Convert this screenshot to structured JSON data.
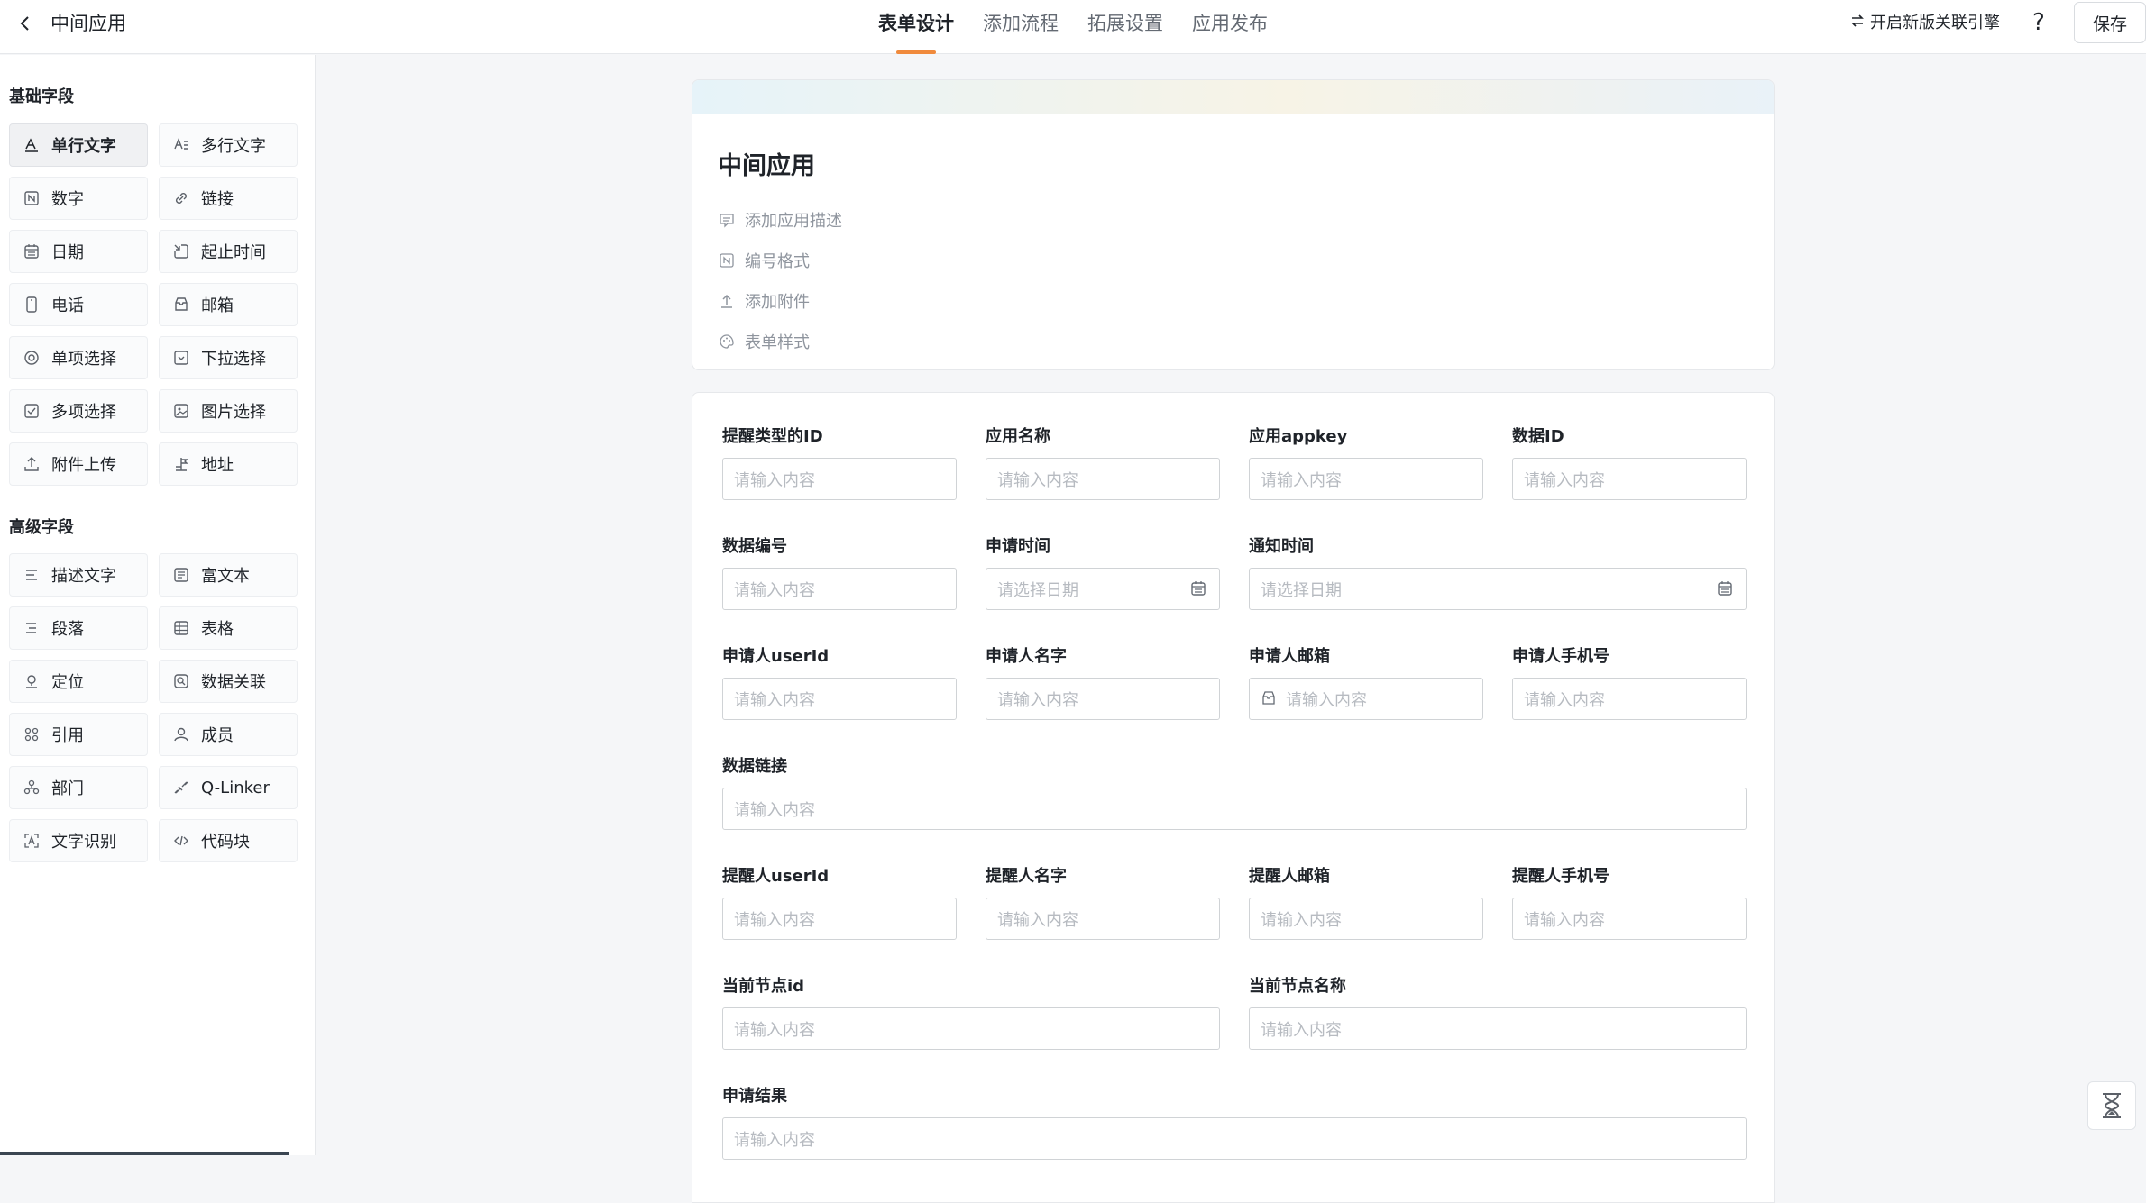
{
  "header": {
    "app_name": "中间应用",
    "tabs": [
      "表单设计",
      "添加流程",
      "拓展设置",
      "应用发布"
    ],
    "active_tab": "表单设计",
    "engine_label": "开启新版关联引擎",
    "help_label": "?",
    "save_label": "保存"
  },
  "sidebar": {
    "basic_title": "基础字段",
    "basic_fields": [
      {
        "label": "单行文字",
        "icon": "single-line-text-icon"
      },
      {
        "label": "多行文字",
        "icon": "multi-line-text-icon"
      },
      {
        "label": "数字",
        "icon": "number-icon"
      },
      {
        "label": "链接",
        "icon": "link-icon"
      },
      {
        "label": "日期",
        "icon": "calendar-icon"
      },
      {
        "label": "起止时间",
        "icon": "time-range-icon"
      },
      {
        "label": "电话",
        "icon": "phone-icon"
      },
      {
        "label": "邮箱",
        "icon": "mail-icon"
      },
      {
        "label": "单项选择",
        "icon": "radio-icon"
      },
      {
        "label": "下拉选择",
        "icon": "dropdown-icon"
      },
      {
        "label": "多项选择",
        "icon": "checkbox-icon"
      },
      {
        "label": "图片选择",
        "icon": "image-icon"
      },
      {
        "label": "附件上传",
        "icon": "upload-icon"
      },
      {
        "label": "地址",
        "icon": "address-icon"
      }
    ],
    "advanced_title": "高级字段",
    "advanced_fields": [
      {
        "label": "描述文字",
        "icon": "description-icon"
      },
      {
        "label": "富文本",
        "icon": "rich-text-icon"
      },
      {
        "label": "段落",
        "icon": "paragraph-icon"
      },
      {
        "label": "表格",
        "icon": "table-icon"
      },
      {
        "label": "定位",
        "icon": "location-icon"
      },
      {
        "label": "数据关联",
        "icon": "data-link-icon"
      },
      {
        "label": "引用",
        "icon": "reference-icon"
      },
      {
        "label": "成员",
        "icon": "member-icon"
      },
      {
        "label": "部门",
        "icon": "department-icon"
      },
      {
        "label": "Q-Linker",
        "icon": "q-linker-icon"
      },
      {
        "label": "文字识别",
        "icon": "ocr-icon"
      },
      {
        "label": "代码块",
        "icon": "code-icon"
      }
    ]
  },
  "form_header": {
    "title": "中间应用",
    "meta": [
      {
        "label": "添加应用描述",
        "icon": "description-icon"
      },
      {
        "label": "编号格式",
        "icon": "number-format-icon"
      },
      {
        "label": "添加附件",
        "icon": "upload-icon"
      },
      {
        "label": "表单样式",
        "icon": "palette-icon"
      }
    ]
  },
  "form": {
    "placeholder_text": "请输入内容",
    "placeholder_date": "请选择日期",
    "fields": [
      {
        "label": "提醒类型的ID",
        "placeholder": "请输入内容"
      },
      {
        "label": "应用名称",
        "placeholder": "请输入内容"
      },
      {
        "label": "应用appkey",
        "placeholder": "请输入内容"
      },
      {
        "label": "数据ID",
        "placeholder": "请输入内容"
      },
      {
        "label": "数据编号",
        "placeholder": "请输入内容"
      },
      {
        "label": "申请时间",
        "placeholder": "请选择日期"
      },
      {
        "label": "通知时间",
        "placeholder": "请选择日期"
      },
      {
        "label": "申请人userId",
        "placeholder": "请输入内容"
      },
      {
        "label": "申请人名字",
        "placeholder": "请输入内容"
      },
      {
        "label": "申请人邮箱",
        "placeholder": "请输入内容"
      },
      {
        "label": "申请人手机号",
        "placeholder": "请输入内容"
      },
      {
        "label": "数据链接",
        "placeholder": "请输入内容"
      },
      {
        "label": "提醒人userId",
        "placeholder": "请输入内容"
      },
      {
        "label": "提醒人名字",
        "placeholder": "请输入内容"
      },
      {
        "label": "提醒人邮箱",
        "placeholder": "请输入内容"
      },
      {
        "label": "提醒人手机号",
        "placeholder": "请输入内容"
      },
      {
        "label": "当前节点id",
        "placeholder": "请输入内容"
      },
      {
        "label": "当前节点名称",
        "placeholder": "请输入内容"
      },
      {
        "label": "申请结果",
        "placeholder": "请输入内容"
      }
    ]
  },
  "colors": {
    "accent": "#f08a3c",
    "border": "#d0d3d6",
    "placeholder": "#b7bbc1"
  }
}
